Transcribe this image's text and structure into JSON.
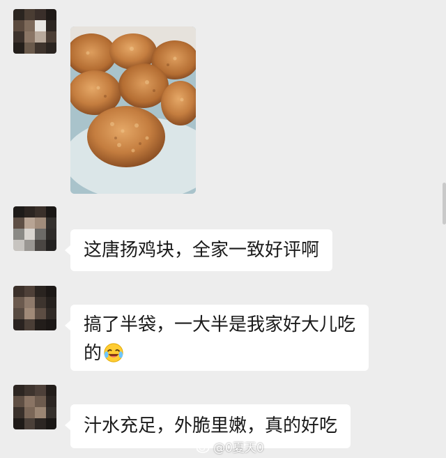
{
  "chat": {
    "messages": [
      {
        "type": "image",
        "alt": "炸鸡块照片"
      },
      {
        "type": "text",
        "lines": [
          "这唐扬鸡块，全家一致好评啊"
        ]
      },
      {
        "type": "text",
        "lines": [
          "搞了半袋，一大半是我家好大儿吃",
          "的"
        ],
        "emoji": "laughing-crying-emoji"
      },
      {
        "type": "text",
        "lines": [
          "汁水充足，外脆里嫩，真的好吃"
        ]
      }
    ]
  },
  "watermark": {
    "text": "@0夏天0",
    "icon": "weibo-icon"
  },
  "colors": {
    "background": "#ededed",
    "bubble": "#ffffff",
    "text": "#1a1a1a"
  }
}
